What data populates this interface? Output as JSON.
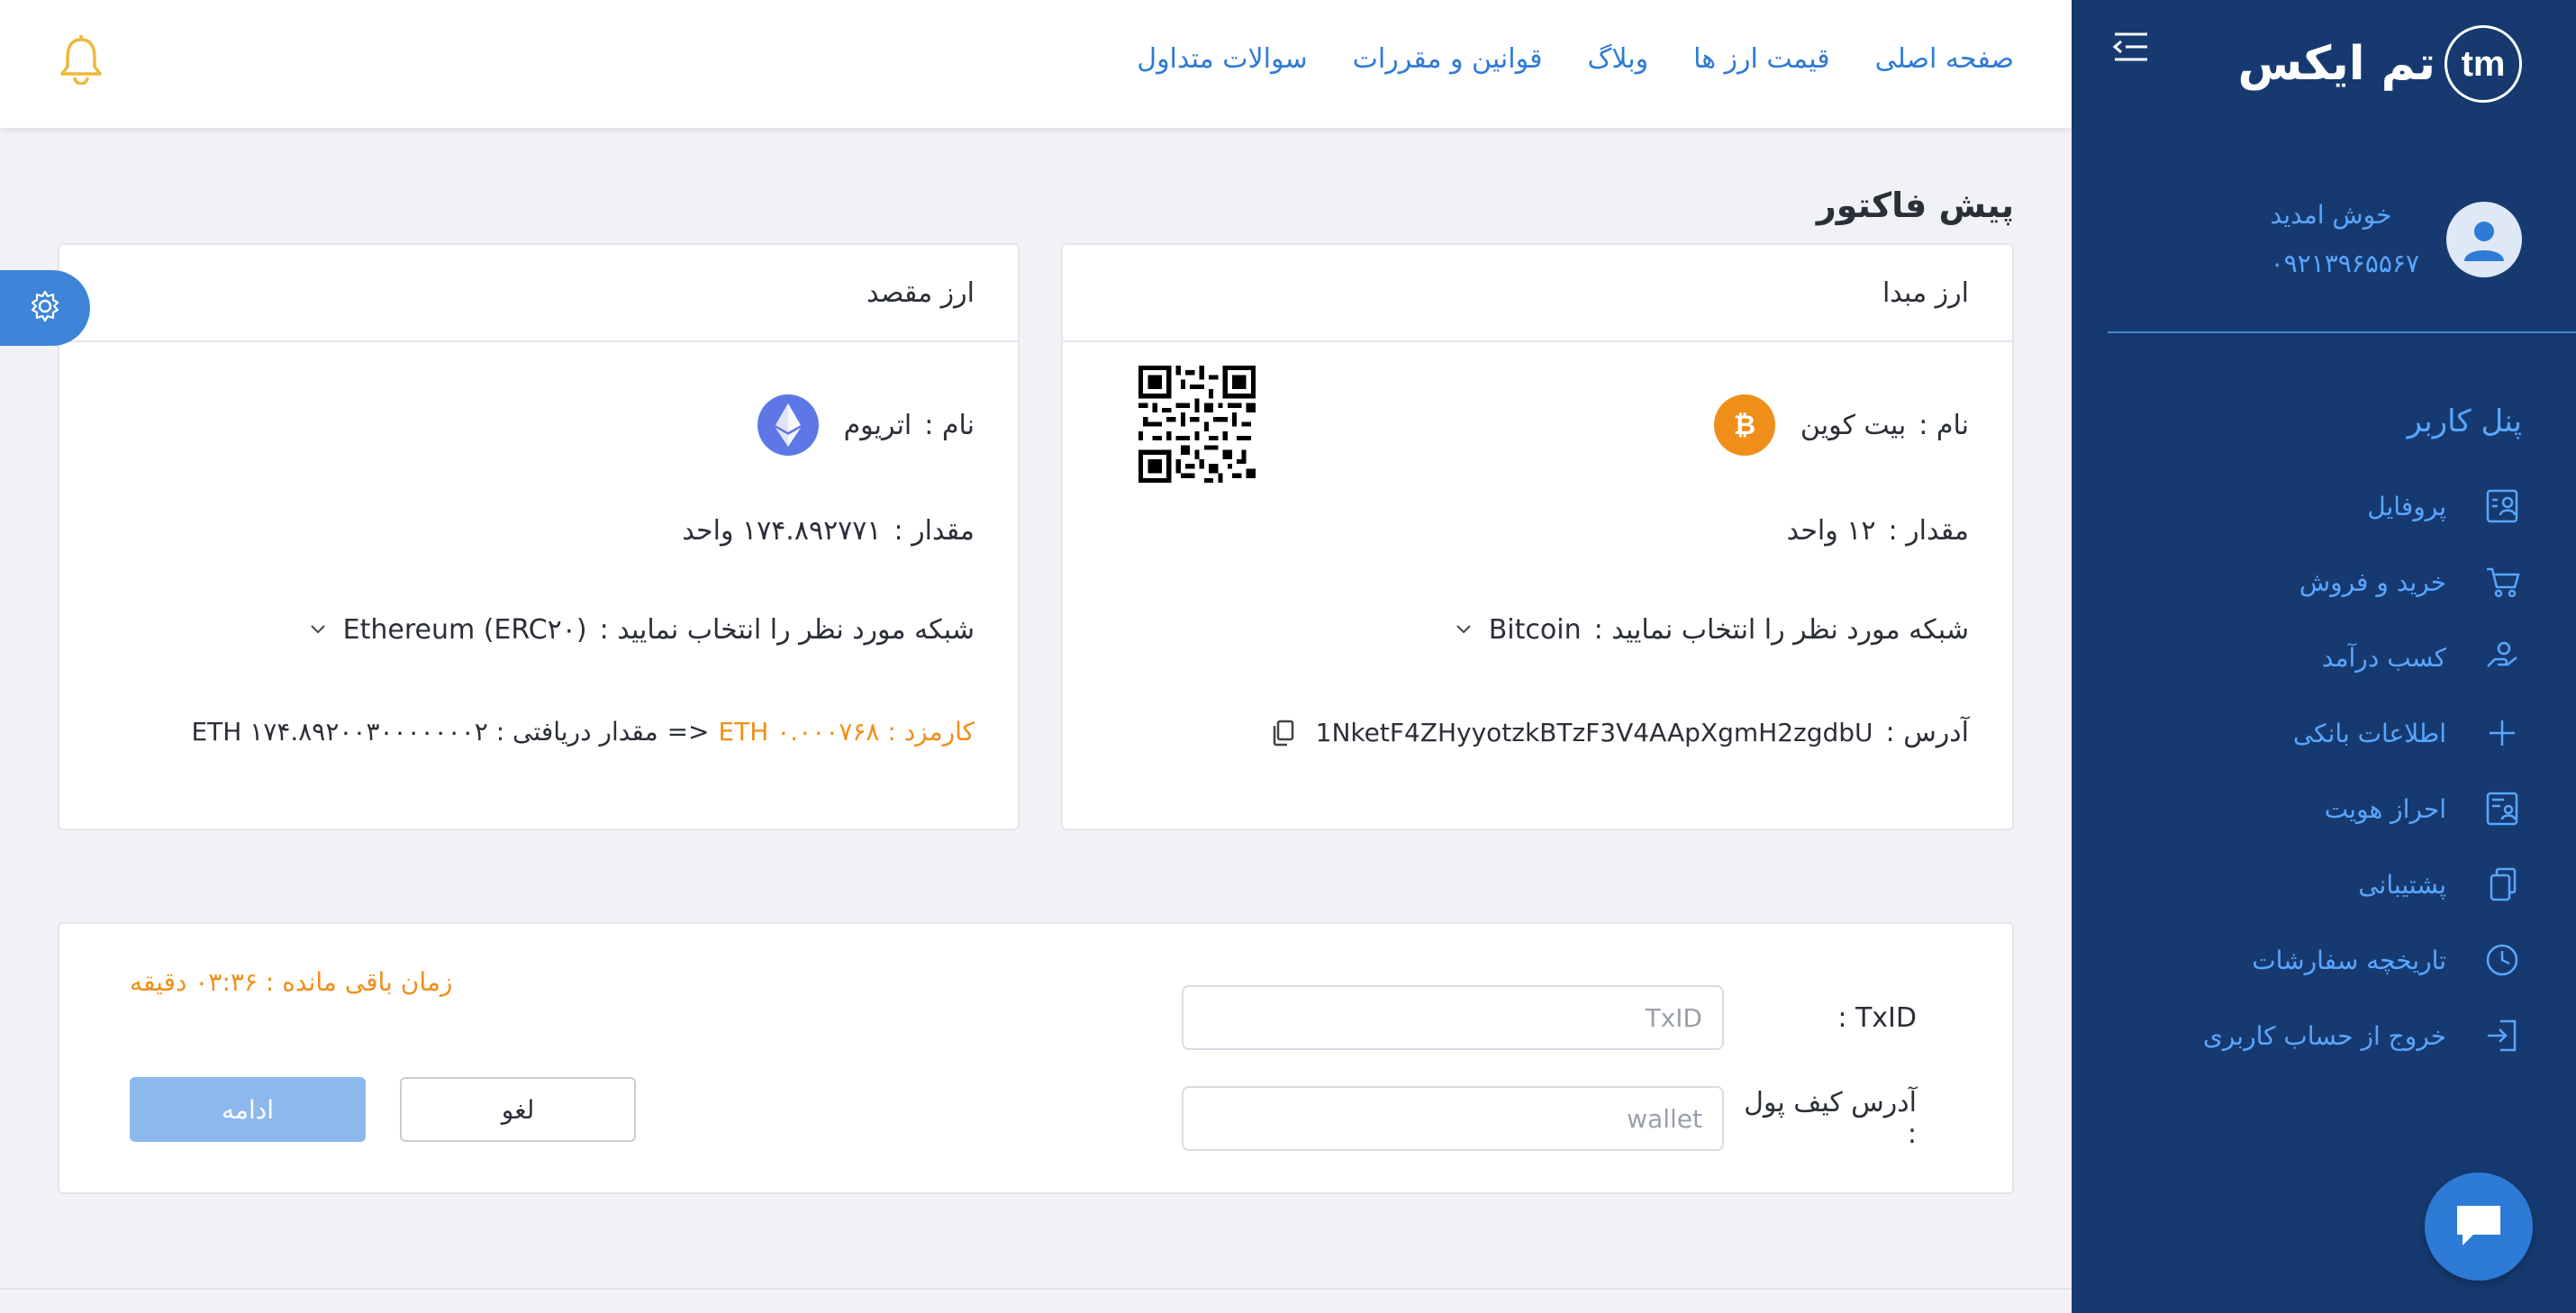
{
  "brand": {
    "name": "تم ایکس",
    "logo_text": "tm"
  },
  "user": {
    "welcome": "خوش امدید",
    "phone": "۰۹۲۱۳۹۶۵۵۶۷"
  },
  "sidebar": {
    "panel_title": "پنل کاربر",
    "items": [
      {
        "label": "پروفایل",
        "icon": "profile-icon"
      },
      {
        "label": "خرید و فروش",
        "icon": "cart-icon"
      },
      {
        "label": "کسب درآمد",
        "icon": "earn-icon"
      },
      {
        "label": "اطلاعات بانکی",
        "icon": "plus-icon"
      },
      {
        "label": "احراز هویت",
        "icon": "id-card-icon"
      },
      {
        "label": "پشتیبانی",
        "icon": "support-icon"
      },
      {
        "label": "تاریخچه سفارشات",
        "icon": "clock-icon"
      },
      {
        "label": "خروج از حساب کاربری",
        "icon": "logout-icon"
      }
    ]
  },
  "topnav": [
    "صفحه اصلی",
    "قیمت ارز ها",
    "وبلاگ",
    "قوانین و مقررات",
    "سوالات متداول"
  ],
  "page_title": "پیش فاکتور",
  "origin": {
    "title": "ارز مبدا",
    "name_label": "نام :",
    "name": "بیت کوین",
    "amount_label": "مقدار :",
    "amount": "۱۲ واحد",
    "network_label": "شبکه مورد نظر را انتخاب نمایید :",
    "network": "Bitcoin",
    "address_label": "آدرس :",
    "address": "1NketF4ZHyyotzkBTzF3V4AApXgmH2zgdbU"
  },
  "dest": {
    "title": "ارز مقصد",
    "name_label": "نام :",
    "name": "اتریوم",
    "amount_label": "مقدار :",
    "amount": "۱۷۴.۸۹۲۷۷۱ واحد",
    "network_label": "شبکه مورد نظر را انتخاب نمایید :",
    "network": "Ethereum (ERC۲۰)",
    "fee": "کارمزد : ETH ۰.۰۰۰۷۶۸",
    "arrow": "=>",
    "received": "مقدار دریافتی : ETH ۱۷۴.۸۹۲۰۰۳۰۰۰۰۰۰۰۲"
  },
  "form": {
    "txid_label": "TxID :",
    "txid_placeholder": "TxID",
    "wallet_label": "آدرس کیف پول :",
    "wallet_placeholder": "wallet",
    "timer": "زمان باقی مانده : ۰۳:۳۶ دقیقه",
    "cancel": "لغو",
    "continue": "ادامه"
  },
  "colors": {
    "sidebar_bg": "#163a70",
    "accent": "#2d7bd6",
    "warning": "#ef8f1a",
    "btc": "#ef8f1a",
    "eth": "#5d77e6"
  }
}
